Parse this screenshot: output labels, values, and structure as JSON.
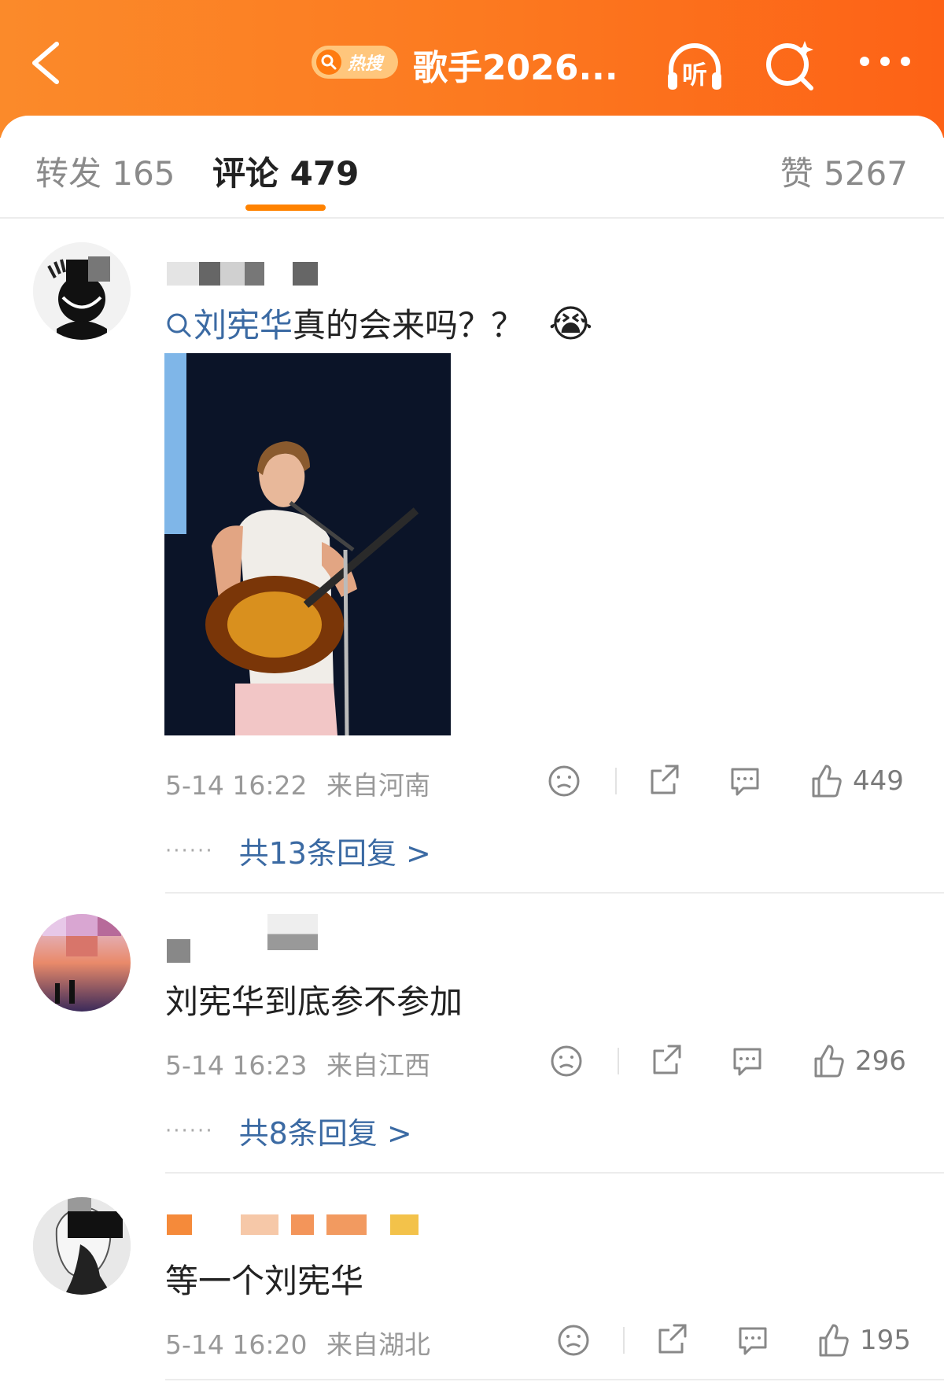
{
  "header": {
    "hot_label": "热搜",
    "title": "歌手2026...",
    "listen_label": "听",
    "icons": [
      "back-icon",
      "search-icon",
      "headphones-icon",
      "search-sparkle-icon",
      "more-icon"
    ]
  },
  "tabs": {
    "repost": "转发 165",
    "comments": "评论 479",
    "likes": "赞 5267"
  },
  "comments": [
    {
      "link": "刘宪华",
      "text": "真的会来吗？？",
      "emoji": "😭",
      "time": "5-14 16:22",
      "location": "来自河南",
      "likes": "449",
      "replies": "共13条回复 >"
    },
    {
      "text": "刘宪华到底参不参加",
      "time": "5-14 16:23",
      "location": "来自江西",
      "likes": "296",
      "replies": "共8条回复 >"
    },
    {
      "text": "等一个刘宪华",
      "time": "5-14 16:20",
      "location": "来自湖北",
      "likes": "195"
    }
  ],
  "colors": {
    "brand_orange": "#fc7a20",
    "link_blue": "#3b6aa3",
    "tab_indicator": "#ff8200"
  }
}
